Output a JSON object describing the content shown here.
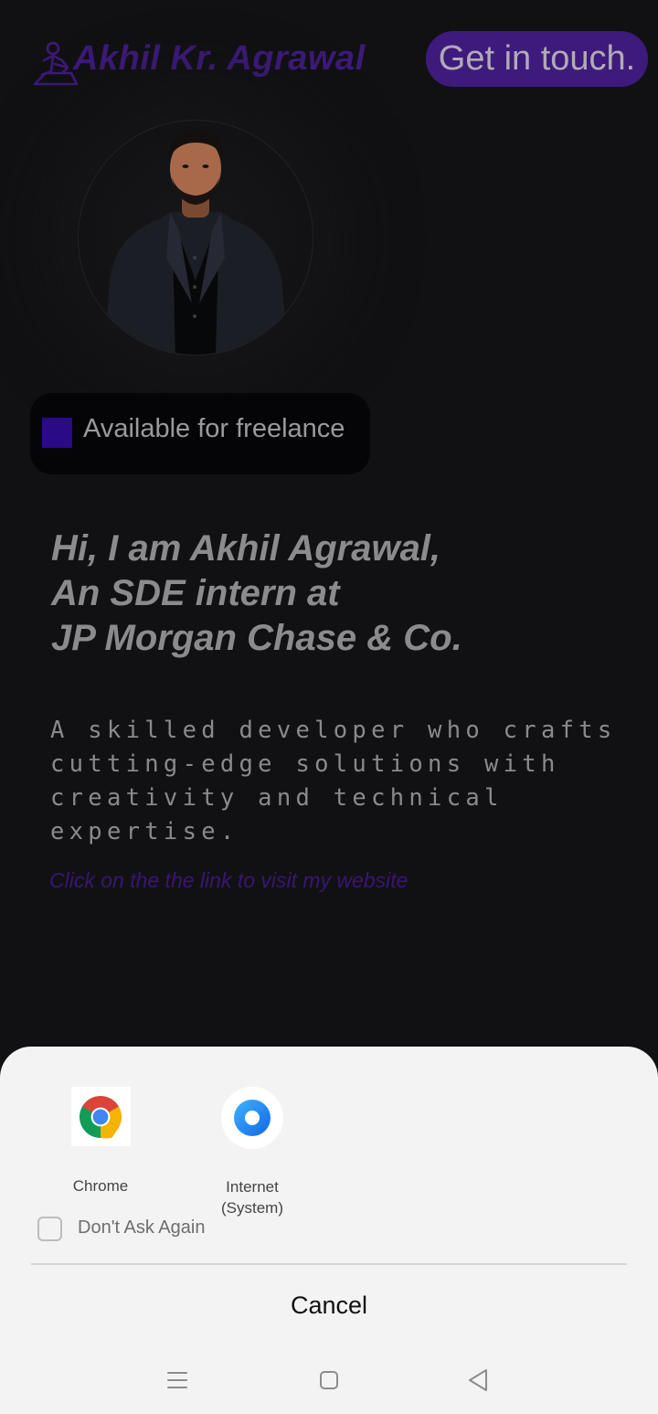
{
  "header": {
    "brand": "Akhil Kr. Agrawal",
    "cta_label": "Get in touch.",
    "logo_icon": "person-at-desk-icon"
  },
  "profile": {
    "avatar": "profile-photo",
    "status_label": "Available for freelance",
    "status_color": "#2a0a86"
  },
  "hero": {
    "headline": [
      "Hi, I am Akhil Agrawal,",
      "An SDE intern at",
      "JP Morgan Chase & Co."
    ],
    "description": [
      "A skilled developer who crafts",
      "cutting-edge solutions with",
      "creativity and technical",
      "expertise."
    ],
    "link_text": "Click on the the link to visit my website"
  },
  "chooser": {
    "apps": [
      {
        "label": "Chrome",
        "icon": "chrome-icon"
      },
      {
        "label": "Internet\n(System)",
        "icon": "internet-browser-icon"
      }
    ],
    "dont_ask_label": "Don't Ask Again",
    "dont_ask_checked": false,
    "cancel_label": "Cancel"
  },
  "navbar": {
    "icons": [
      "menu-icon",
      "home-icon",
      "back-icon"
    ]
  },
  "colors": {
    "background": "#111113",
    "accent": "#3e1a7c",
    "sheet": "#f3f3f3"
  }
}
